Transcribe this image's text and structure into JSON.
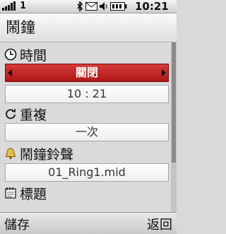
{
  "status": {
    "signal_icon": "signal-bars-icon",
    "sim": "1",
    "bluetooth_icon": "bluetooth-icon",
    "message_icon": "envelope-icon",
    "sound_icon": "speaker-icon",
    "battery_icon": "battery-icon",
    "time": "10:21"
  },
  "screen": {
    "title": "鬧鐘"
  },
  "settings": {
    "time_label": "時間",
    "state_value": "關閉",
    "time_value": "10 : 21",
    "repeat_label": "重複",
    "repeat_value": "一次",
    "ringtone_label": "鬧鐘鈴聲",
    "ringtone_value": "01_Ring1.mid",
    "name_label": "標題"
  },
  "softkeys": {
    "left": "儲存",
    "right": "返回"
  },
  "colors": {
    "selected": "#c02626"
  }
}
